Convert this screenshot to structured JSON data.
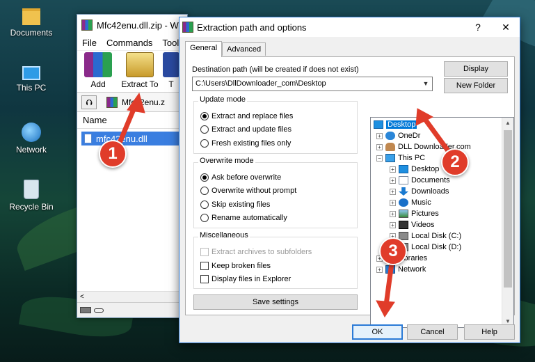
{
  "desktop": {
    "icons": [
      {
        "label": "Documents",
        "icon": "folder-documents-icon"
      },
      {
        "label": "This PC",
        "icon": "this-pc-icon"
      },
      {
        "label": "Network",
        "icon": "network-icon"
      },
      {
        "label": "Recycle Bin",
        "icon": "recycle-bin-icon"
      }
    ]
  },
  "winrar": {
    "title": "Mfc42enu.dll.zip - W",
    "menu": [
      "File",
      "Commands",
      "Tools"
    ],
    "toolbar": {
      "add": "Add",
      "extract_to": "Extract To",
      "next": "T"
    },
    "path": "Mfc42enu.z",
    "column_name": "Name",
    "file_row": "mfc42enu.dll",
    "scroll_left": "<"
  },
  "dialog": {
    "title": "Extraction path and options",
    "help_glyph": "?",
    "close_glyph": "✕",
    "tabs": [
      "General",
      "Advanced"
    ],
    "destination_label": "Destination path (will be created if does not exist)",
    "destination_value": "C:\\Users\\DllDownloader_com\\Desktop",
    "display_button": "Display",
    "new_folder_button": "New Folder",
    "update_mode": {
      "title": "Update mode",
      "options": [
        "Extract and replace files",
        "Extract and update files",
        "Fresh existing files only"
      ],
      "selected": 0
    },
    "overwrite_mode": {
      "title": "Overwrite mode",
      "options": [
        "Ask before overwrite",
        "Overwrite without prompt",
        "Skip existing files",
        "Rename automatically"
      ],
      "selected": 0
    },
    "misc": {
      "title": "Miscellaneous",
      "options": [
        "Extract archives to subfolders",
        "Keep broken files",
        "Display files in Explorer"
      ]
    },
    "save_settings": "Save settings",
    "tree": [
      {
        "label": "Desktop",
        "expander": "",
        "selected": true
      },
      {
        "label": "OneDr",
        "expander": "+"
      },
      {
        "label": "DLL Downloader.com",
        "expander": "+"
      },
      {
        "label": "This PC",
        "expander": "−"
      },
      {
        "label": "Desktop",
        "expander": "+"
      },
      {
        "label": "Documents",
        "expander": "+"
      },
      {
        "label": "Downloads",
        "expander": "+"
      },
      {
        "label": "Music",
        "expander": "+"
      },
      {
        "label": "Pictures",
        "expander": "+"
      },
      {
        "label": "Videos",
        "expander": "+"
      },
      {
        "label": "Local Disk (C:)",
        "expander": "+"
      },
      {
        "label": "Local Disk (D:)",
        "expander": "+"
      },
      {
        "label": "Libraries",
        "expander": "+"
      },
      {
        "label": "Network",
        "expander": "+"
      }
    ],
    "ok": "OK",
    "cancel": "Cancel",
    "help": "Help"
  },
  "annotations": {
    "step1": "1",
    "step2": "2",
    "step3": "3"
  },
  "colors": {
    "annotation": "#e03c2a",
    "selection": "#0078d7",
    "accent_border": "#2d7ad6"
  }
}
